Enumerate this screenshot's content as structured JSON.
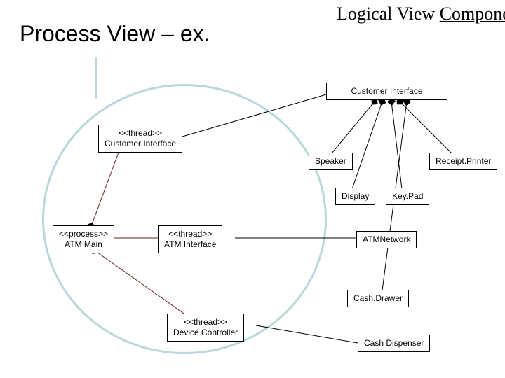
{
  "titles": {
    "main": "Process View – ex.",
    "sub_line1": "Logical View",
    "sub_line2": "Components"
  },
  "boxes": {
    "customer_iface_lv": {
      "l1": "Customer Interface"
    },
    "customer_iface_th": {
      "l1": "<<thread>>",
      "l2": "Customer Interface"
    },
    "speaker": {
      "l1": "Speaker"
    },
    "receipt_printer": {
      "l1": "Receipt.Printer"
    },
    "display": {
      "l1": "Display"
    },
    "keypad": {
      "l1": "Key.Pad"
    },
    "atm_main": {
      "l1": "<<process>>",
      "l2": "ATM Main"
    },
    "atm_iface": {
      "l1": "<<thread>>",
      "l2": "ATM Interface"
    },
    "atm_network": {
      "l1": "ATMNetwork"
    },
    "cash_drawer": {
      "l1": "Cash.Drawer"
    },
    "device_ctrl": {
      "l1": "<<thread>>",
      "l2": "Device Controller"
    },
    "cash_dispenser": {
      "l1": "Cash Dispenser"
    }
  },
  "chart_data": {
    "type": "diagram",
    "title": "Process View – ex. / Logical View Components",
    "nodes": [
      {
        "id": "atm_main",
        "label": "<<process>> ATM Main",
        "group": "process"
      },
      {
        "id": "customer_iface_th",
        "label": "<<thread>> Customer Interface",
        "group": "process"
      },
      {
        "id": "atm_iface",
        "label": "<<thread>> ATM Interface",
        "group": "process"
      },
      {
        "id": "device_ctrl",
        "label": "<<thread>> Device Controller",
        "group": "process"
      },
      {
        "id": "customer_iface_lv",
        "label": "Customer Interface",
        "group": "logical"
      },
      {
        "id": "speaker",
        "label": "Speaker",
        "group": "logical"
      },
      {
        "id": "receipt_printer",
        "label": "Receipt.Printer",
        "group": "logical"
      },
      {
        "id": "display",
        "label": "Display",
        "group": "logical"
      },
      {
        "id": "keypad",
        "label": "Key.Pad",
        "group": "logical"
      },
      {
        "id": "atm_network",
        "label": "ATMNetwork",
        "group": "logical"
      },
      {
        "id": "cash_drawer",
        "label": "Cash.Drawer",
        "group": "logical"
      },
      {
        "id": "cash_dispenser",
        "label": "Cash Dispenser",
        "group": "logical"
      }
    ],
    "edges": [
      {
        "from": "atm_main",
        "to": "customer_iface_th",
        "style": "composition"
      },
      {
        "from": "atm_main",
        "to": "atm_iface",
        "style": "composition"
      },
      {
        "from": "atm_main",
        "to": "device_ctrl",
        "style": "composition"
      },
      {
        "from": "customer_iface_th",
        "to": "customer_iface_lv",
        "style": "assoc"
      },
      {
        "from": "atm_iface",
        "to": "atm_network",
        "style": "assoc"
      },
      {
        "from": "device_ctrl",
        "to": "cash_dispenser",
        "style": "assoc"
      },
      {
        "from": "speaker",
        "to": "customer_iface_lv",
        "style": "assoc-diamond"
      },
      {
        "from": "display",
        "to": "customer_iface_lv",
        "style": "assoc-diamond"
      },
      {
        "from": "keypad",
        "to": "customer_iface_lv",
        "style": "assoc-diamond"
      },
      {
        "from": "receipt_printer",
        "to": "customer_iface_lv",
        "style": "assoc-diamond"
      },
      {
        "from": "cash_drawer",
        "to": "customer_iface_lv",
        "style": "assoc-diamond"
      }
    ]
  }
}
